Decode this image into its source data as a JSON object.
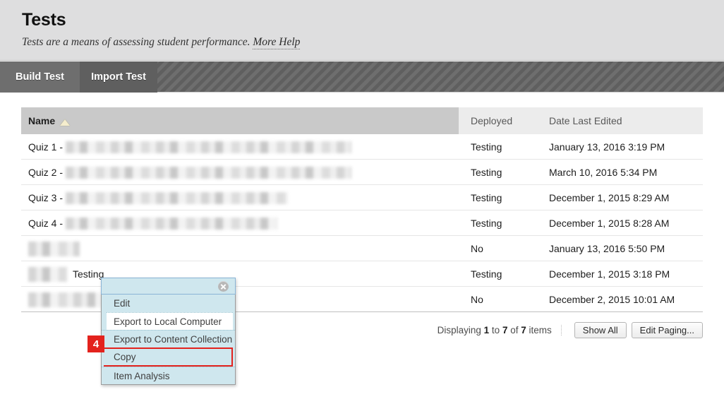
{
  "header": {
    "title": "Tests",
    "description": "Tests are a means of assessing student performance.",
    "help_link": "More Help"
  },
  "actionbar": {
    "tabs": [
      {
        "label": "Build Test"
      },
      {
        "label": "Import Test"
      }
    ]
  },
  "table": {
    "columns": {
      "name": "Name",
      "deployed": "Deployed",
      "date_last_edited": "Date Last Edited"
    },
    "sort_icon": "sort-ascending-triangle-icon",
    "rows": [
      {
        "name_prefix": "Quiz 1 -",
        "name_suffix": "",
        "redacted_width": 405,
        "deployed": "Testing",
        "date": "January 13, 2016 3:19 PM"
      },
      {
        "name_prefix": "Quiz 2 -",
        "name_suffix": "",
        "redacted_width": 405,
        "deployed": "Testing",
        "date": "March 10, 2016 5:34 PM"
      },
      {
        "name_prefix": "Quiz 3 -",
        "name_suffix": "",
        "redacted_width": 315,
        "deployed": "Testing",
        "date": "December 1, 2015 8:29 AM"
      },
      {
        "name_prefix": "Quiz 4 -",
        "name_suffix": "",
        "redacted_width": 300,
        "deployed": "Testing",
        "date": "December 1, 2015 8:28 AM"
      },
      {
        "name_prefix": "",
        "name_suffix": "",
        "redacted_width": 73,
        "deployed": "No",
        "date": "January 13, 2016 5:50 PM"
      },
      {
        "name_prefix": "",
        "name_suffix": "Testing",
        "redacted_width": 55,
        "deployed": "Testing",
        "date": "December 1, 2015 3:18 PM"
      },
      {
        "name_prefix": "",
        "name_suffix": "",
        "redacted_width": 110,
        "deployed": "No",
        "date": "December 2, 2015 10:01 AM"
      }
    ]
  },
  "pagination": {
    "displaying_prefix": "Displaying",
    "from": "1",
    "to_word": "to",
    "to": "7",
    "of_word": "of",
    "total": "7",
    "items_word": "items",
    "show_all": "Show All",
    "edit_paging": "Edit Paging..."
  },
  "context_menu": {
    "close_icon": "close-circle-icon",
    "items": [
      {
        "label": "Edit"
      },
      {
        "label": "Export to Local Computer"
      },
      {
        "label": "Export to Content Collection"
      },
      {
        "label": "Copy"
      },
      {
        "label": "Item Analysis"
      }
    ]
  },
  "annotation": {
    "step_number": "4",
    "highlight_color": "#e3221d"
  }
}
